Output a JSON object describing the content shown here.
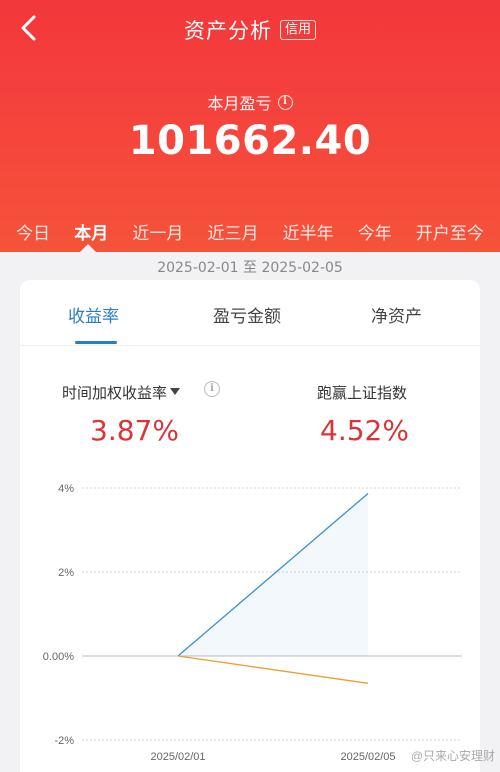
{
  "header": {
    "title": "资产分析",
    "badge": "信用",
    "pnl_label": "本月盈亏",
    "pnl_value": "101662.40",
    "accent_color": "#f3373b",
    "back_icon": "chevron-left-icon"
  },
  "period_tabs": [
    {
      "label": "今日",
      "active": false
    },
    {
      "label": "本月",
      "active": true
    },
    {
      "label": "近一月",
      "active": false
    },
    {
      "label": "近三月",
      "active": false
    },
    {
      "label": "近半年",
      "active": false
    },
    {
      "label": "今年",
      "active": false
    },
    {
      "label": "开户至今",
      "active": false
    }
  ],
  "date_range": "2025-02-01 至 2025-02-05",
  "card": {
    "tabs": [
      {
        "label": "收益率",
        "active": true
      },
      {
        "label": "盈亏金额",
        "active": false
      },
      {
        "label": "净资产",
        "active": false
      }
    ],
    "metrics": [
      {
        "label": "时间加权收益率",
        "value": "3.87%"
      },
      {
        "label": "跑赢上证指数",
        "value": "4.52%"
      }
    ]
  },
  "chart_data": {
    "type": "line",
    "y_ticks": [
      "4%",
      "2%",
      "0.00%",
      "-2%"
    ],
    "x_ticks": [
      "2025/02/01",
      "2025/02/05"
    ],
    "ylim": [
      -2,
      4
    ],
    "series": [
      {
        "color": "#3b8fd0",
        "x": [
          "2025/02/01",
          "2025/02/05"
        ],
        "values": [
          0,
          3.87
        ]
      },
      {
        "color": "#e8a22f",
        "x": [
          "2025/02/01",
          "2025/02/05"
        ],
        "values": [
          0,
          -0.65
        ]
      }
    ],
    "grid": true
  },
  "watermark": "@只来心安理财"
}
